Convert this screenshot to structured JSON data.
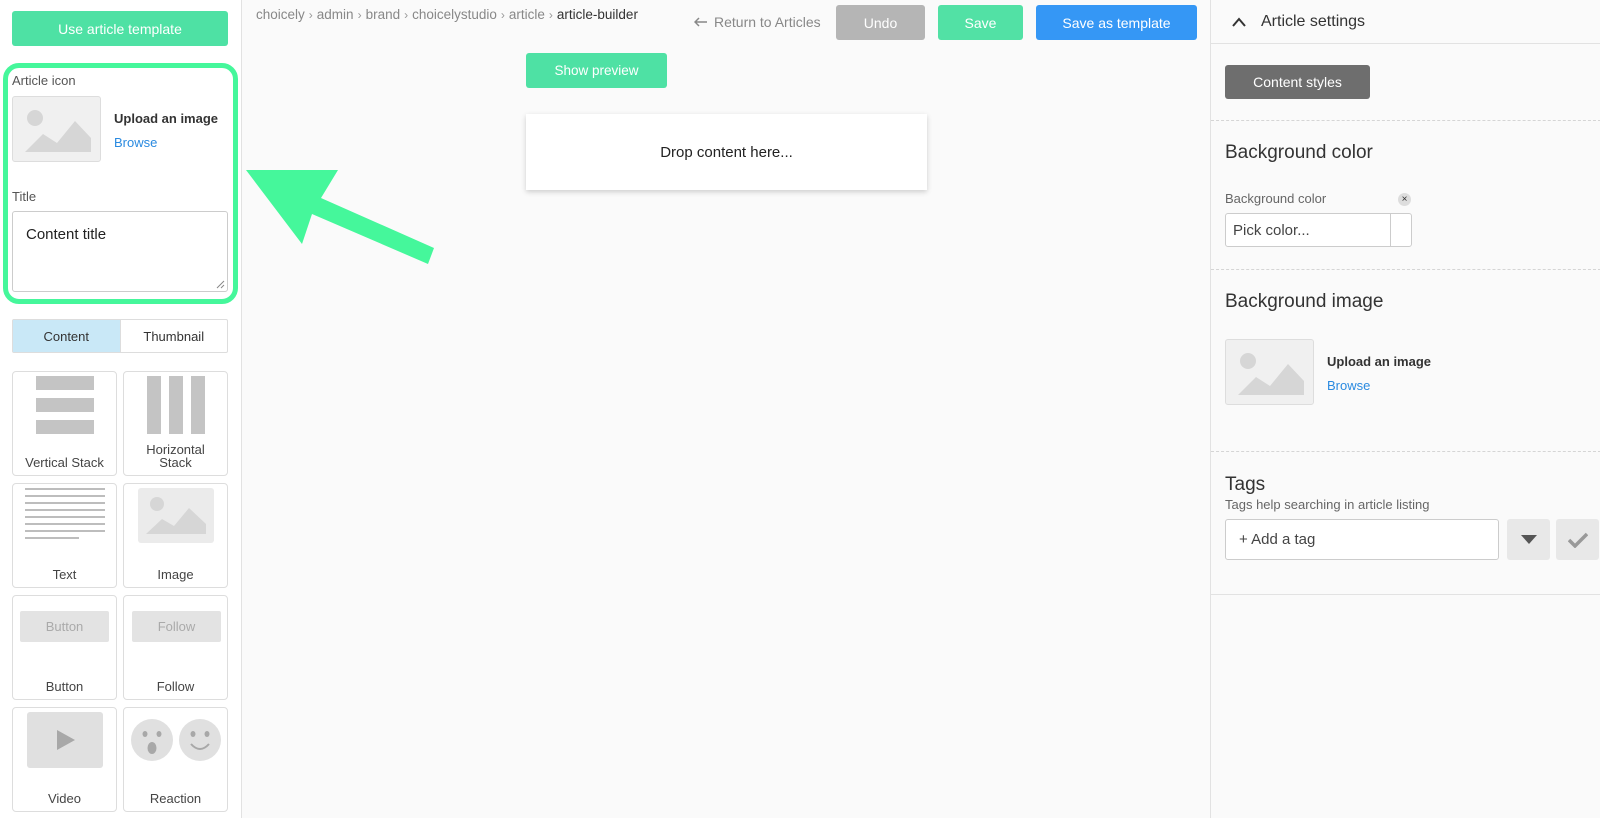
{
  "left": {
    "template_button": "Use article template",
    "icon_label": "Article icon",
    "upload_label": "Upload an image",
    "browse_label": "Browse",
    "title_label": "Title",
    "title_value": "Content title",
    "tabs": [
      {
        "label": "Content",
        "active": true
      },
      {
        "label": "Thumbnail",
        "active": false
      }
    ],
    "tiles": [
      {
        "label": "Vertical Stack"
      },
      {
        "label": "Horizontal Stack"
      },
      {
        "label": "Text"
      },
      {
        "label": "Image"
      },
      {
        "label": "Button",
        "preview_text": "Button"
      },
      {
        "label": "Follow",
        "preview_text": "Follow"
      },
      {
        "label": "Video"
      },
      {
        "label": "Reaction"
      }
    ]
  },
  "breadcrumb": [
    "choicely",
    "admin",
    "brand",
    "choicelystudio",
    "article",
    "article-builder"
  ],
  "toolbar": {
    "return_label": "Return to Articles",
    "undo_label": "Undo",
    "save_label": "Save",
    "save_template_label": "Save as template",
    "preview_label": "Show preview"
  },
  "canvas": {
    "drop_text": "Drop content here..."
  },
  "right": {
    "header_title": "Article settings",
    "styles_button": "Content styles",
    "bg_color_title": "Background color",
    "bg_color_label": "Background color",
    "bg_color_placeholder": "Pick color...",
    "bg_image_title": "Background image",
    "upload_label": "Upload an image",
    "browse_label": "Browse",
    "tags_title": "Tags",
    "tags_help": "Tags help searching in article listing",
    "tag_placeholder": "+ Add a tag"
  },
  "colors": {
    "green": "#4ee1a4",
    "blue": "#3597f5",
    "highlight": "#45f79b",
    "link": "#2a8ae0"
  }
}
